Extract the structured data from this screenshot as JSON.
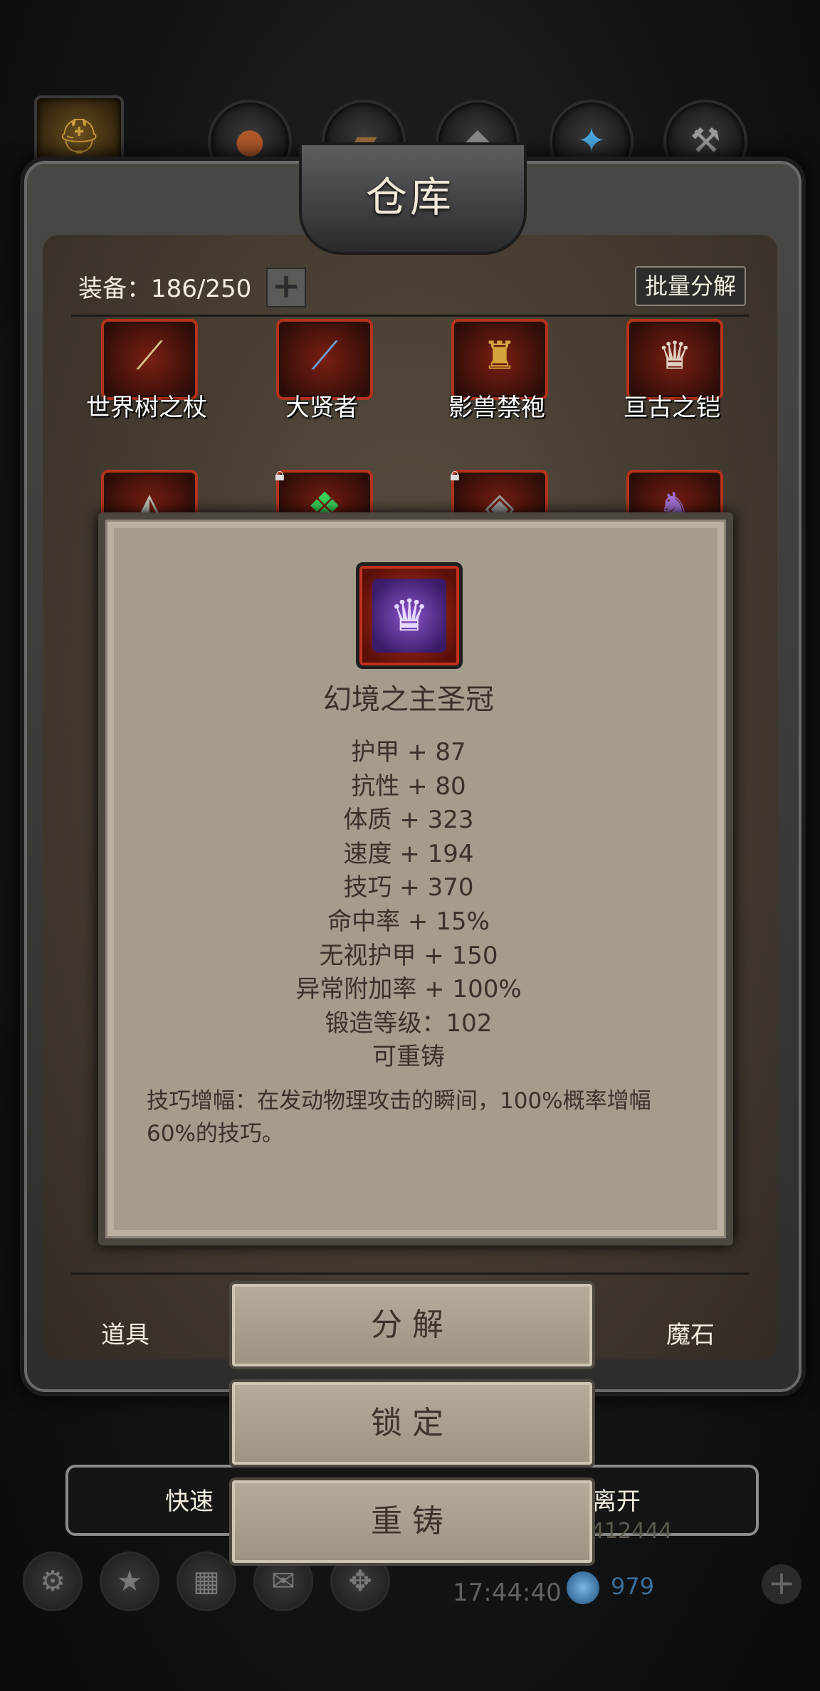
{
  "top_tabs": [
    {
      "icon": "helmet-icon",
      "active": true
    },
    {
      "icon": "lute-icon",
      "active": false
    },
    {
      "icon": "scroll-icon",
      "active": false
    },
    {
      "icon": "anvil-icon",
      "active": false
    },
    {
      "icon": "crystal-icon",
      "active": false
    },
    {
      "icon": "hammer-icon",
      "active": false
    }
  ],
  "panel": {
    "title": "仓库",
    "equipment_count": "装备：186/250",
    "batch_decompose_label": "批量分解"
  },
  "items_row1": [
    {
      "label": "世界树之杖",
      "icon": "staff-icon"
    },
    {
      "label": "大贤者",
      "icon": "wand-icon"
    },
    {
      "label": "影兽禁袍",
      "icon": "robe-icon"
    },
    {
      "label": "亘古之铠",
      "icon": "armor-icon"
    }
  ],
  "items_row2": [
    {
      "icon": "pauldron-icon",
      "locked": false
    },
    {
      "icon": "glove-icon",
      "locked": true
    },
    {
      "icon": "chestplate-icon",
      "locked": true
    },
    {
      "icon": "helm-icon",
      "locked": false
    }
  ],
  "popup": {
    "icon": "crown-icon",
    "name": "幻境之主圣冠",
    "stats": [
      "护甲 + 87",
      "抗性 + 80",
      "体质 + 323",
      "速度 + 194",
      "技巧 + 370",
      "命中率 + 15%",
      "无视护甲 + 150",
      "异常附加率 + 100%",
      "锻造等级：102",
      "可重铸"
    ],
    "description": "技巧增幅：在发动物理攻击的瞬间，100%概率增幅60%的技巧。"
  },
  "bottom_tabs": {
    "left": "道具",
    "right": "魔石"
  },
  "actions": {
    "decompose": "分解",
    "lock": "锁定",
    "reforge": "重铸"
  },
  "quickbar": {
    "left_partial": "快速",
    "right_partial": "离开"
  },
  "status": {
    "time": "17:44:40",
    "gems": "979",
    "gold": "412444"
  }
}
